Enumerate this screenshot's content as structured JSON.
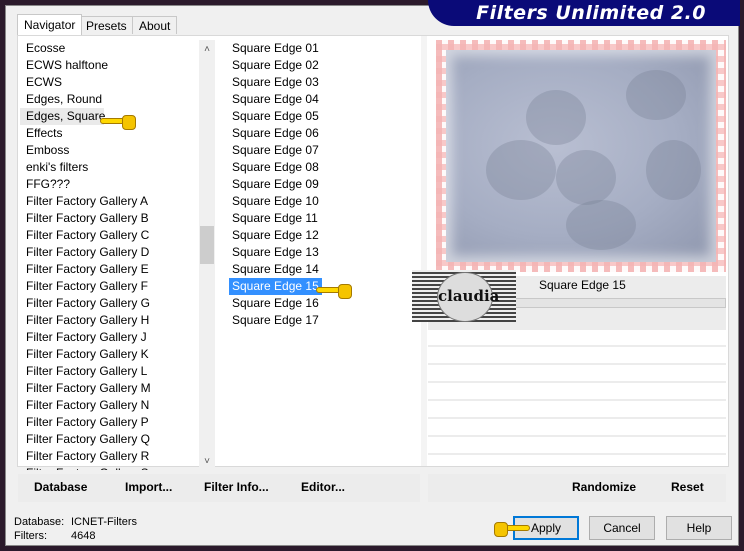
{
  "window": {
    "title": "Filters Unlimited 2.0"
  },
  "tabs": [
    {
      "label": "Navigator",
      "active": true
    },
    {
      "label": "Presets",
      "active": false
    },
    {
      "label": "About",
      "active": false
    }
  ],
  "categories": {
    "highlighted": "Edges, Square",
    "items": [
      "Ecosse",
      "ECWS halftone",
      "ECWS",
      "Edges, Round",
      "Edges, Square",
      "Effects",
      "Emboss",
      "enki's filters",
      "FFG???",
      "Filter Factory Gallery A",
      "Filter Factory Gallery B",
      "Filter Factory Gallery C",
      "Filter Factory Gallery D",
      "Filter Factory Gallery E",
      "Filter Factory Gallery F",
      "Filter Factory Gallery G",
      "Filter Factory Gallery H",
      "Filter Factory Gallery J",
      "Filter Factory Gallery K",
      "Filter Factory Gallery L",
      "Filter Factory Gallery M",
      "Filter Factory Gallery N",
      "Filter Factory Gallery P",
      "Filter Factory Gallery Q",
      "Filter Factory Gallery R",
      "Filter Factory Gallery S"
    ]
  },
  "filters": {
    "selected": "Square Edge 15",
    "items": [
      "Square Edge 01",
      "Square Edge 02",
      "Square Edge 03",
      "Square Edge 04",
      "Square Edge 05",
      "Square Edge 06",
      "Square Edge 07",
      "Square Edge 08",
      "Square Edge 09",
      "Square Edge 10",
      "Square Edge 11",
      "Square Edge 12",
      "Square Edge 13",
      "Square Edge 14",
      "Square Edge 15",
      "Square Edge 16",
      "Square Edge 17"
    ]
  },
  "preview": {
    "filter_name": "Square Edge 15",
    "watermark": "claudia"
  },
  "left_buttons": {
    "database": "Database",
    "import": "Import...",
    "filter_info": "Filter Info...",
    "editor": "Editor..."
  },
  "right_buttons": {
    "randomize": "Randomize",
    "reset": "Reset"
  },
  "status": {
    "database_label": "Database:",
    "database_value": "ICNET-Filters",
    "filters_label": "Filters:",
    "filters_value": "4648"
  },
  "dialog_buttons": {
    "apply": "Apply",
    "cancel": "Cancel",
    "help": "Help"
  },
  "colors": {
    "title_bg": "#0a0a78",
    "selection": "#3390ff",
    "default_button_border": "#0078d7"
  }
}
